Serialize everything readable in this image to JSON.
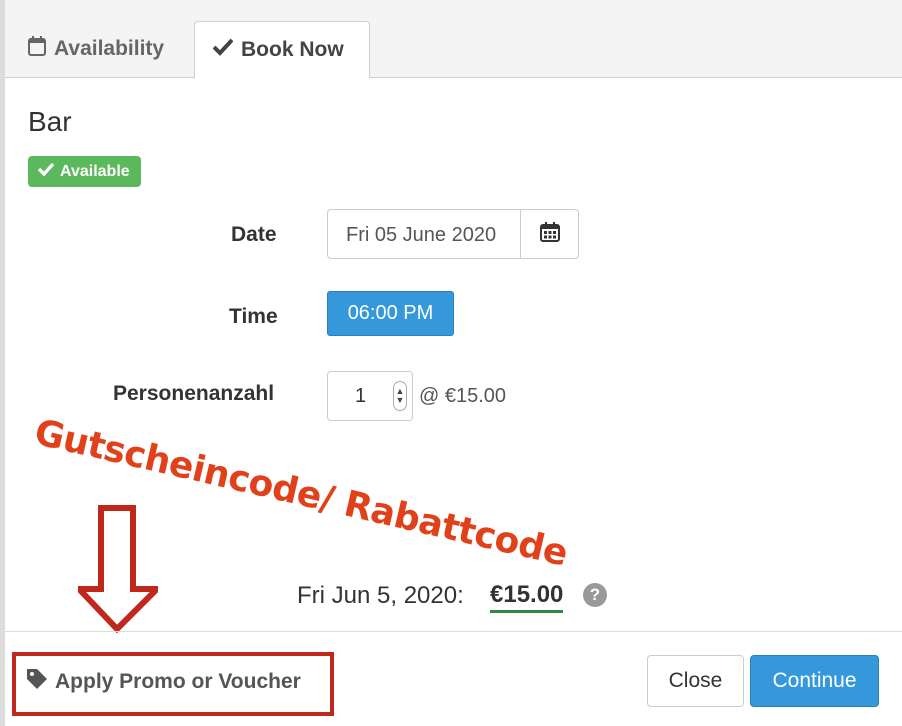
{
  "tabs": [
    {
      "label": "Availability",
      "icon": "calendar-icon"
    },
    {
      "label": "Book Now",
      "icon": "check-icon"
    }
  ],
  "item": {
    "title": "Bar",
    "status": "Available",
    "status_color": "#5cb85c"
  },
  "form": {
    "date_label": "Date",
    "date_value": "Fri 05 June 2020",
    "time_label": "Time",
    "time_value": "06:00 PM",
    "guests_label": "Personenanzahl",
    "guests_value": "1",
    "price_per": "@ €15.00"
  },
  "annotation": {
    "text": "Gutscheincode/ Rabattcode",
    "color": "#e0411b"
  },
  "summary": {
    "date": "Fri Jun 5, 2020:",
    "total": "€15.00",
    "help": "?"
  },
  "footer": {
    "promo_label": "Apply Promo or Voucher",
    "close_label": "Close",
    "continue_label": "Continue",
    "accent": "#3498db"
  }
}
